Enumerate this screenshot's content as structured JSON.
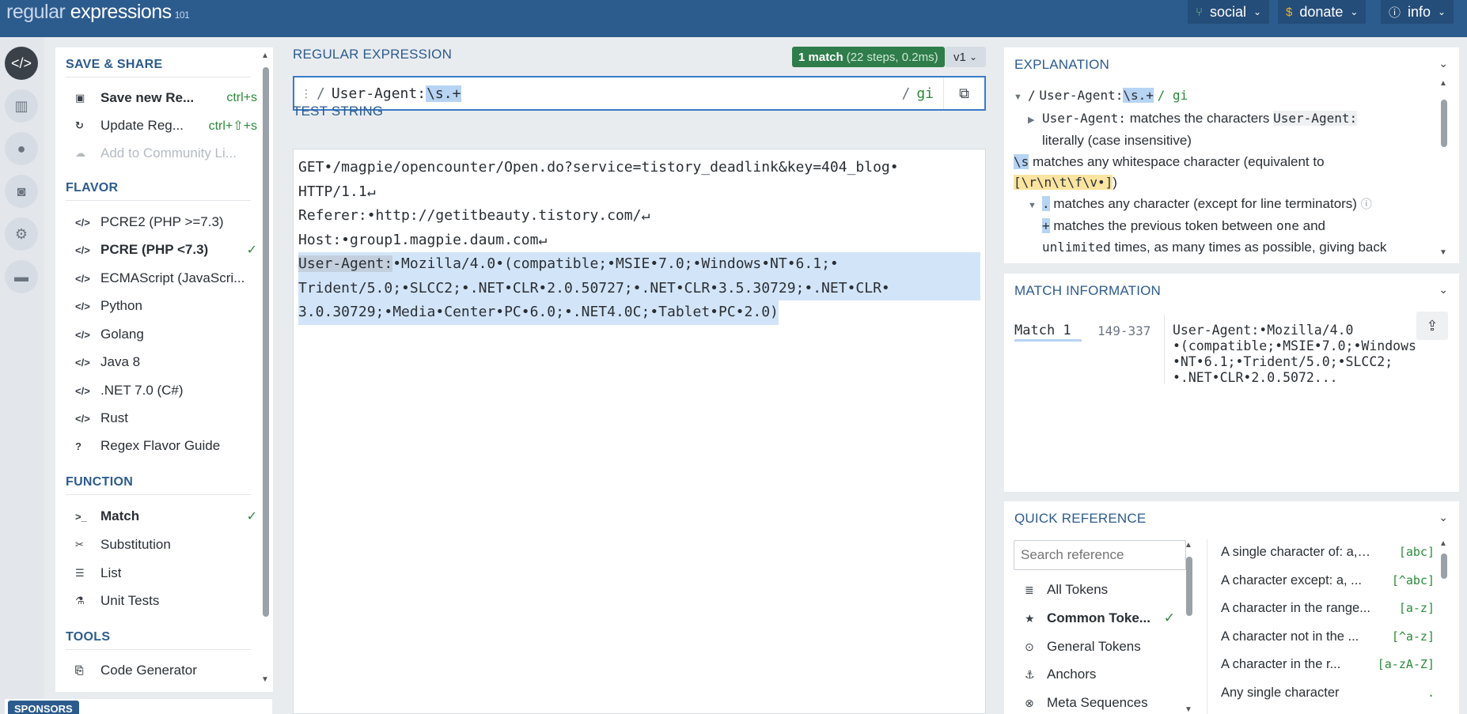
{
  "header": {
    "logo_light": "regular",
    "logo_bold": "expressions",
    "logo_version": "101",
    "social": "social",
    "donate": "donate",
    "info": "info"
  },
  "left": {
    "save_share": {
      "title": "SAVE & SHARE",
      "save_new": "Save new Re...",
      "save_new_shortcut": "ctrl+s",
      "update": "Update Reg...",
      "update_shortcut": "ctrl+⇧+s",
      "community": "Add to Community Li..."
    },
    "flavor": {
      "title": "FLAVOR",
      "items": [
        "PCRE2 (PHP >=7.3)",
        "PCRE (PHP <7.3)",
        "ECMAScript (JavaScri...",
        "Python",
        "Golang",
        "Java 8",
        ".NET 7.0 (C#)",
        "Rust"
      ],
      "guide": "Regex Flavor Guide"
    },
    "function": {
      "title": "FUNCTION",
      "items": [
        "Match",
        "Substitution",
        "List",
        "Unit Tests"
      ]
    },
    "tools": {
      "title": "TOOLS",
      "code_generator": "Code Generator"
    },
    "sponsors": "SPONSORS"
  },
  "regex": {
    "label": "REGULAR EXPRESSION",
    "match_count": "1 match",
    "match_detail": "(22 steps, 0.2ms)",
    "version": "v1",
    "delimiter": "/",
    "literal": "User-Agent:",
    "highlighted": "\\s.+",
    "flags_delim": "/",
    "flags": "gi"
  },
  "test_string": {
    "label": "TEST STRING",
    "line1": "GET•/magpie/opencounter/Open.do?service=tistory_deadlink&key=404_blog•",
    "line2": "HTTP/1.1↵",
    "line3": "Referer:•http://getitbeauty.tistory.com/↵",
    "line4": "Host:•group1.magpie.daum.com↵",
    "match_part1": "User-Agent:",
    "match_part2": "•Mozilla/4.0•(compatible;•MSIE•7.0;•Windows•NT•6.1;•",
    "match_line2": "Trident/5.0;•SLCC2;•.NET•CLR•2.0.50727;•.NET•CLR•3.5.30729;•.NET•CLR•",
    "match_line3": "3.0.30729;•Media•Center•PC•6.0;•.NET4.0C;•Tablet•PC•2.0)"
  },
  "explanation": {
    "title": "EXPLANATION",
    "root_delim": "/",
    "root_literal": "User-Agent:",
    "root_token": "\\s.+",
    "root_flags": "/ gi",
    "l1_token": "User-Agent:",
    "l1_text": "matches the characters",
    "l1_code": "User-Agent:",
    "l1_text2": "literally (case insensitive)",
    "l2_token": "\\s",
    "l2_text": "matches any whitespace character (equivalent to",
    "l2_code": "[\\r\\n\\t\\f\\v•]",
    "l2_close": ")",
    "l3_token": ".",
    "l3_text": "matches any character (except for line terminators)",
    "l4_token": "+",
    "l4_text": "matches the previous token between",
    "l4_one": "one",
    "l4_and": "and",
    "l5_unlimited": "unlimited",
    "l5_text": "times, as many times as possible, giving back"
  },
  "match_info": {
    "title": "MATCH INFORMATION",
    "match_name": "Match 1",
    "match_range": "149-337",
    "match_value": "User-Agent:•Mozilla/4.0\n•(compatible;•MSIE•7.0;•Windows\n•NT•6.1;•Trident/5.0;•SLCC2;\n•.NET•CLR•2.0.5072..."
  },
  "quick_ref": {
    "title": "QUICK REFERENCE",
    "search_placeholder": "Search reference",
    "categories": [
      "All Tokens",
      "Common Toke...",
      "General Tokens",
      "Anchors",
      "Meta Sequences"
    ],
    "rows": [
      {
        "desc": "A single character of: a, ...",
        "token": "[abc]"
      },
      {
        "desc": "A character except: a, ...",
        "token": "[^abc]"
      },
      {
        "desc": "A character in the range...",
        "token": "[a-z]"
      },
      {
        "desc": "A character not in the ...",
        "token": "[^a-z]"
      },
      {
        "desc": "A character in the r...",
        "token": "[a-zA-Z]"
      },
      {
        "desc": "Any single character",
        "token": "."
      }
    ]
  }
}
